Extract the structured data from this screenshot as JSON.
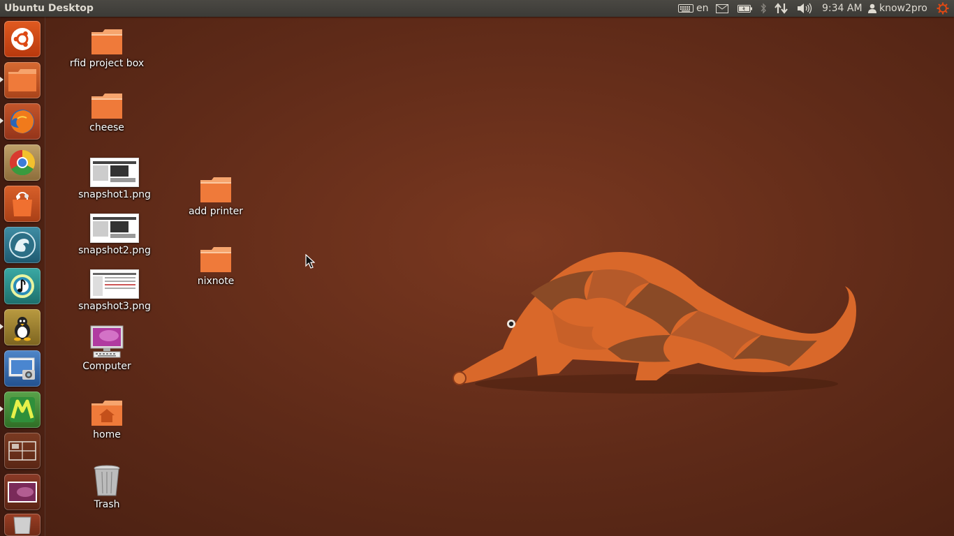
{
  "panel": {
    "title": "Ubuntu Desktop",
    "keyboard_layout": "en",
    "clock": "9:34 AM",
    "user": "know2pro",
    "indicators": [
      "keyboard-icon",
      "mail-icon",
      "battery-icon",
      "bluetooth-icon",
      "network-icon",
      "volume-icon",
      "user-icon",
      "power-gear-icon"
    ]
  },
  "launcher": {
    "items": [
      {
        "name": "dash-home",
        "icon": "ubuntu-logo-icon"
      },
      {
        "name": "files",
        "icon": "folder-icon"
      },
      {
        "name": "firefox",
        "icon": "firefox-icon"
      },
      {
        "name": "chrome",
        "icon": "chrome-icon"
      },
      {
        "name": "software-center",
        "icon": "shopping-bag-icon"
      },
      {
        "name": "app",
        "icon": "dragon-icon"
      },
      {
        "name": "music",
        "icon": "music-note-icon"
      },
      {
        "name": "app",
        "icon": "tux-icon"
      },
      {
        "name": "screenshot",
        "icon": "camera-icon"
      },
      {
        "name": "app",
        "icon": "m-logo-icon"
      },
      {
        "name": "workspace-switcher",
        "icon": "workspaces-icon"
      },
      {
        "name": "app",
        "icon": "desktop-preview-icon"
      },
      {
        "name": "trash",
        "icon": "trash-icon"
      }
    ]
  },
  "desktop": {
    "icons": [
      {
        "label": "rfid project box",
        "type": "folder"
      },
      {
        "label": "cheese",
        "type": "folder"
      },
      {
        "label": "snapshot1.png",
        "type": "image"
      },
      {
        "label": "snapshot2.png",
        "type": "image"
      },
      {
        "label": "snapshot3.png",
        "type": "image"
      },
      {
        "label": "Computer",
        "type": "computer"
      },
      {
        "label": "home",
        "type": "home-folder"
      },
      {
        "label": "Trash",
        "type": "trash"
      },
      {
        "label": "add printer",
        "type": "folder"
      },
      {
        "label": "nixnote",
        "type": "folder"
      }
    ]
  },
  "colors": {
    "wallpaper": "#5e2a18",
    "panel": "#3c3b37",
    "folder_orange": "#ef7a3a",
    "accent": "#dd4814"
  }
}
